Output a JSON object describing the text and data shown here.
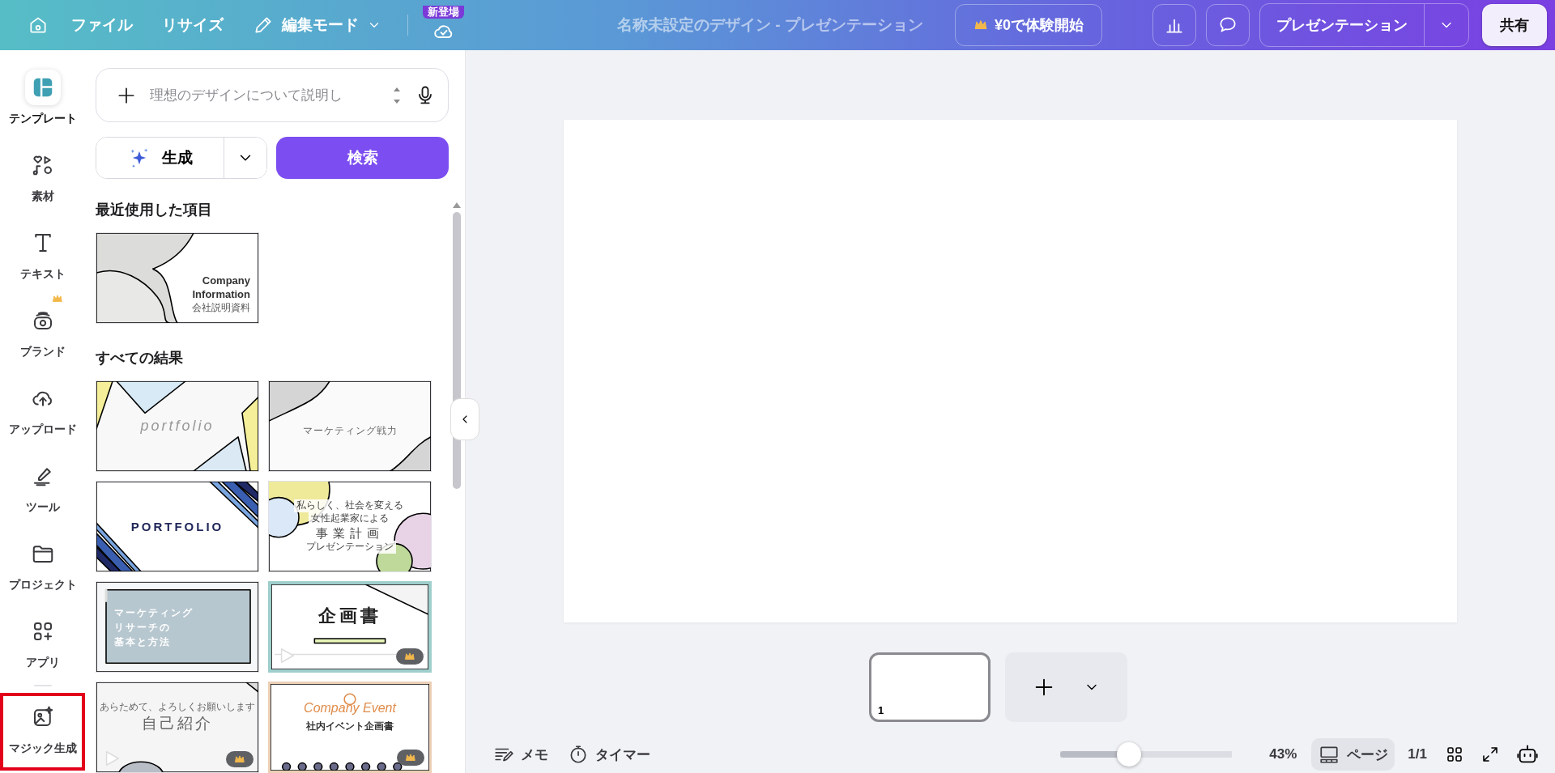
{
  "top_bar": {
    "menu": [
      {
        "label": "ファイル"
      },
      {
        "label": "リサイズ"
      }
    ],
    "edit_mode": "編集モード",
    "new_badge": "新登場",
    "title": "名称未設定のデザイン - プレゼンテーション",
    "trial_button": "¥0で体験開始",
    "present_button": "プレゼンテーション",
    "share_button": "共有"
  },
  "sidebar": {
    "items": [
      {
        "kind": "template",
        "label": "テンプレート",
        "selected": true,
        "premium": false,
        "highlighted": false
      },
      {
        "kind": "elements",
        "label": "素材",
        "selected": false,
        "premium": false,
        "highlighted": false
      },
      {
        "kind": "text",
        "label": "テキスト",
        "selected": false,
        "premium": false,
        "highlighted": false
      },
      {
        "kind": "brand",
        "label": "ブランド",
        "selected": false,
        "premium": true,
        "highlighted": false
      },
      {
        "kind": "upload",
        "label": "アップロード",
        "selected": false,
        "premium": false,
        "highlighted": false
      },
      {
        "kind": "tools",
        "label": "ツール",
        "selected": false,
        "premium": false,
        "highlighted": false
      },
      {
        "kind": "projects",
        "label": "プロジェクト",
        "selected": false,
        "premium": false,
        "highlighted": false
      },
      {
        "kind": "apps",
        "label": "アプリ",
        "selected": false,
        "premium": false,
        "highlighted": false
      },
      {
        "kind": "magic",
        "label": "マジック生成",
        "selected": false,
        "premium": false,
        "highlighted": true
      }
    ]
  },
  "panel": {
    "prompt": {
      "placeholder": "理想のデザインについて説明し"
    },
    "generate_button": "生成",
    "search_button": "検索",
    "sections": [
      {
        "heading": "最近使用した項目",
        "templates": [
          {
            "kind": "blob",
            "lines": [
              "Company",
              "Information",
              "会社説明資料"
            ],
            "premium": false,
            "video": false
          }
        ]
      },
      {
        "heading": "すべての結果",
        "templates": [
          {
            "kind": "pastel",
            "lines": [
              "portfolio"
            ],
            "premium": false,
            "video": false
          },
          {
            "kind": "gray",
            "lines": [
              "マーケティング戦力"
            ],
            "premium": false,
            "video": false
          },
          {
            "kind": "stripes",
            "lines": [
              "PORTFOLIO"
            ],
            "premium": false,
            "video": false
          },
          {
            "kind": "circles",
            "lines": [
              "私らしく、社会を変える",
              "女性起業家による",
              "事業計画",
              "プレゼンテーション"
            ],
            "premium": false,
            "video": false
          },
          {
            "kind": "grid",
            "lines": [
              "マーケティング",
              "リサーチの",
              "基本と方法"
            ],
            "premium": false,
            "video": false
          },
          {
            "kind": "frame",
            "lines": [
              "企画書"
            ],
            "premium": true,
            "video": true
          },
          {
            "kind": "intro",
            "lines": [
              "あらためて、よろしくお願いします",
              "自己紹介"
            ],
            "premium": true,
            "video": true
          },
          {
            "kind": "event",
            "lines": [
              "Company Event",
              "社内イベント企画書"
            ],
            "premium": true,
            "video": false
          }
        ]
      }
    ]
  },
  "canvas": {
    "pages": [
      {
        "number": "1",
        "selected": true
      }
    ]
  },
  "footer": {
    "notes": "メモ",
    "timer": "タイマー",
    "zoom": {
      "level": 0.4,
      "reading": "43%"
    },
    "page_view": "ページ",
    "page_count": "1/1"
  }
}
